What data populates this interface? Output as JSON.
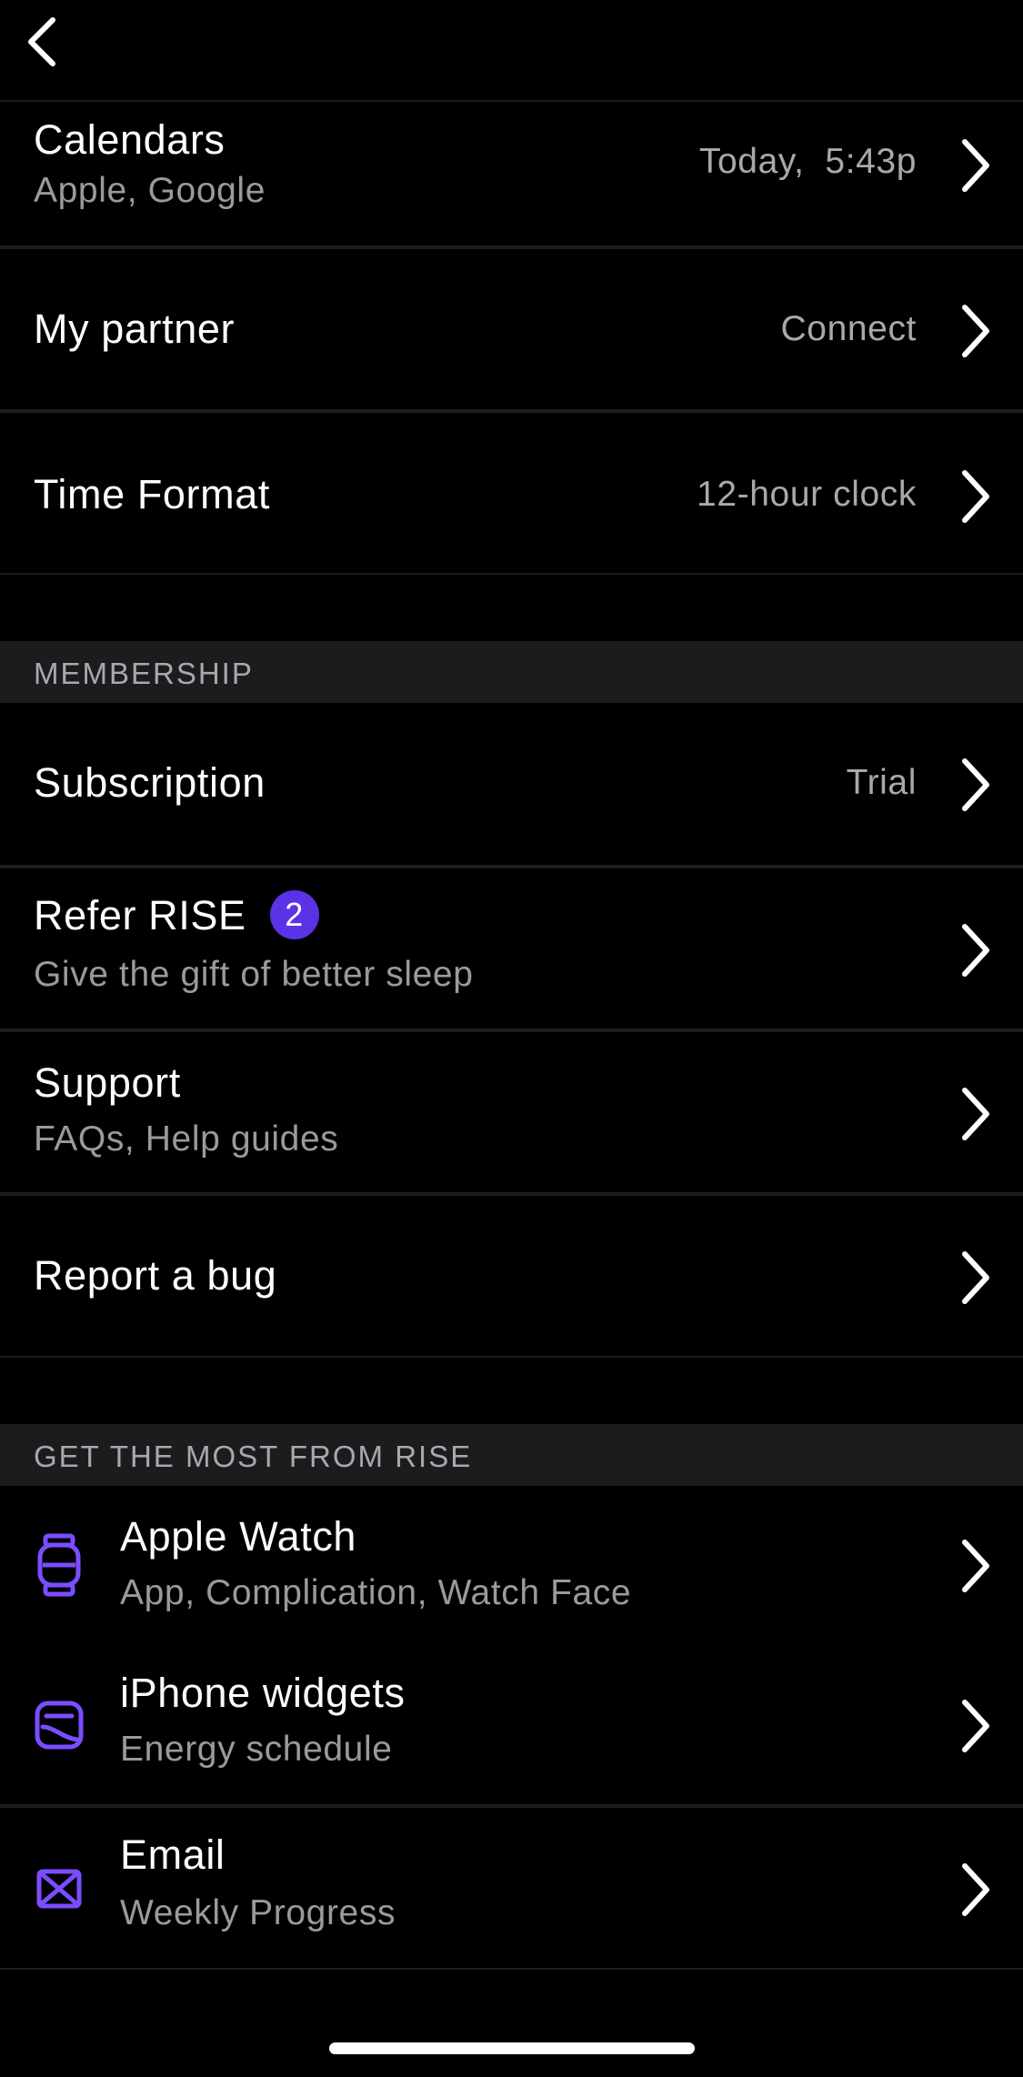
{
  "colors": {
    "background": "#000000",
    "separator": "#1c1c1e",
    "accent": "#7b4dff",
    "badge": "#5b33e6"
  },
  "nav": {
    "back_icon": "chevron-left-icon"
  },
  "rows_top": [
    {
      "title": "Calendars",
      "subtitle": "Apple, Google",
      "value": "Today,  5:43p"
    },
    {
      "title": "My partner",
      "value": "Connect"
    },
    {
      "title": "Time Format",
      "value": "12-hour clock"
    }
  ],
  "membership": {
    "header": "MEMBERSHIP",
    "subscription": {
      "title": "Subscription",
      "value": "Trial"
    },
    "refer": {
      "title": "Refer RISE",
      "badge": "2",
      "subtitle": "Give the gift of better sleep"
    },
    "support": {
      "title": "Support",
      "subtitle": "FAQs, Help guides"
    },
    "bug": {
      "title": "Report a bug"
    }
  },
  "most": {
    "header": "GET THE MOST FROM RISE",
    "watch": {
      "title": "Apple Watch",
      "subtitle": "App, Complication, Watch Face",
      "icon": "watch-icon"
    },
    "widgets": {
      "title": "iPhone widgets",
      "subtitle": "Energy schedule",
      "icon": "widget-icon"
    },
    "email": {
      "title": "Email",
      "subtitle": "Weekly Progress",
      "icon": "envelope-icon"
    }
  }
}
